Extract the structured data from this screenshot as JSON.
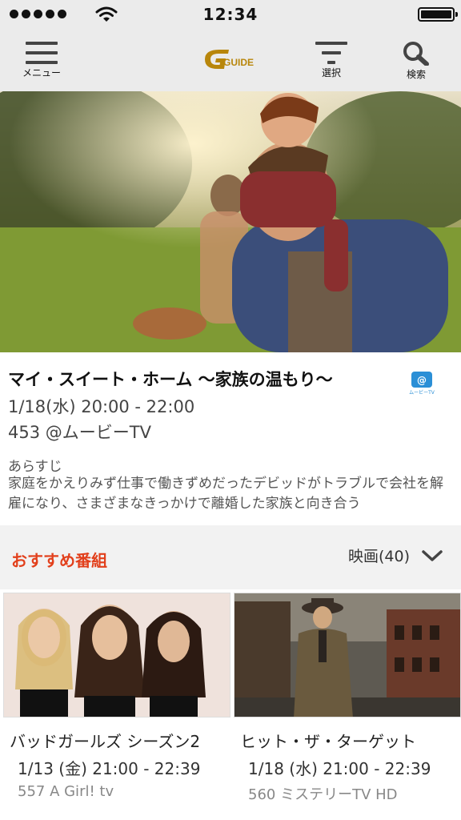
{
  "status_bar": {
    "time": "12:34"
  },
  "nav": {
    "menu_label": "メニュー",
    "logo_text": "GUIDE",
    "select_label": "選択",
    "search_label": "検索"
  },
  "program": {
    "title": "マイ・スイート・ホーム ～家族の温もり～",
    "time": "1/18(水) 20:00 - 22:00",
    "channel": "453 @ムービーTV",
    "channel_badge": "ムービーTV",
    "synopsis_label": "あらすじ",
    "synopsis": "家庭をかえりみず仕事で働きずめだったデビッドがトラブルで会社を解雇になり、さまざまなきっかけで離婚した家族と向き合う"
  },
  "recommended": {
    "title": "おすすめ番組",
    "filter_label": "映画(40)",
    "items": [
      {
        "title": "バッドガールズ シーズン2",
        "time": "1/13 (金) 21:00 - 22:39",
        "channel": "557 A Girl! tv"
      },
      {
        "title": "ヒット・ザ・ターゲット",
        "time": "1/18 (水) 21:00 - 22:39",
        "channel": "560 ミステリーTV HD"
      }
    ]
  },
  "colors": {
    "accent": "#e2401c",
    "bar": "#ebebeb",
    "logo": "#b8860b"
  }
}
